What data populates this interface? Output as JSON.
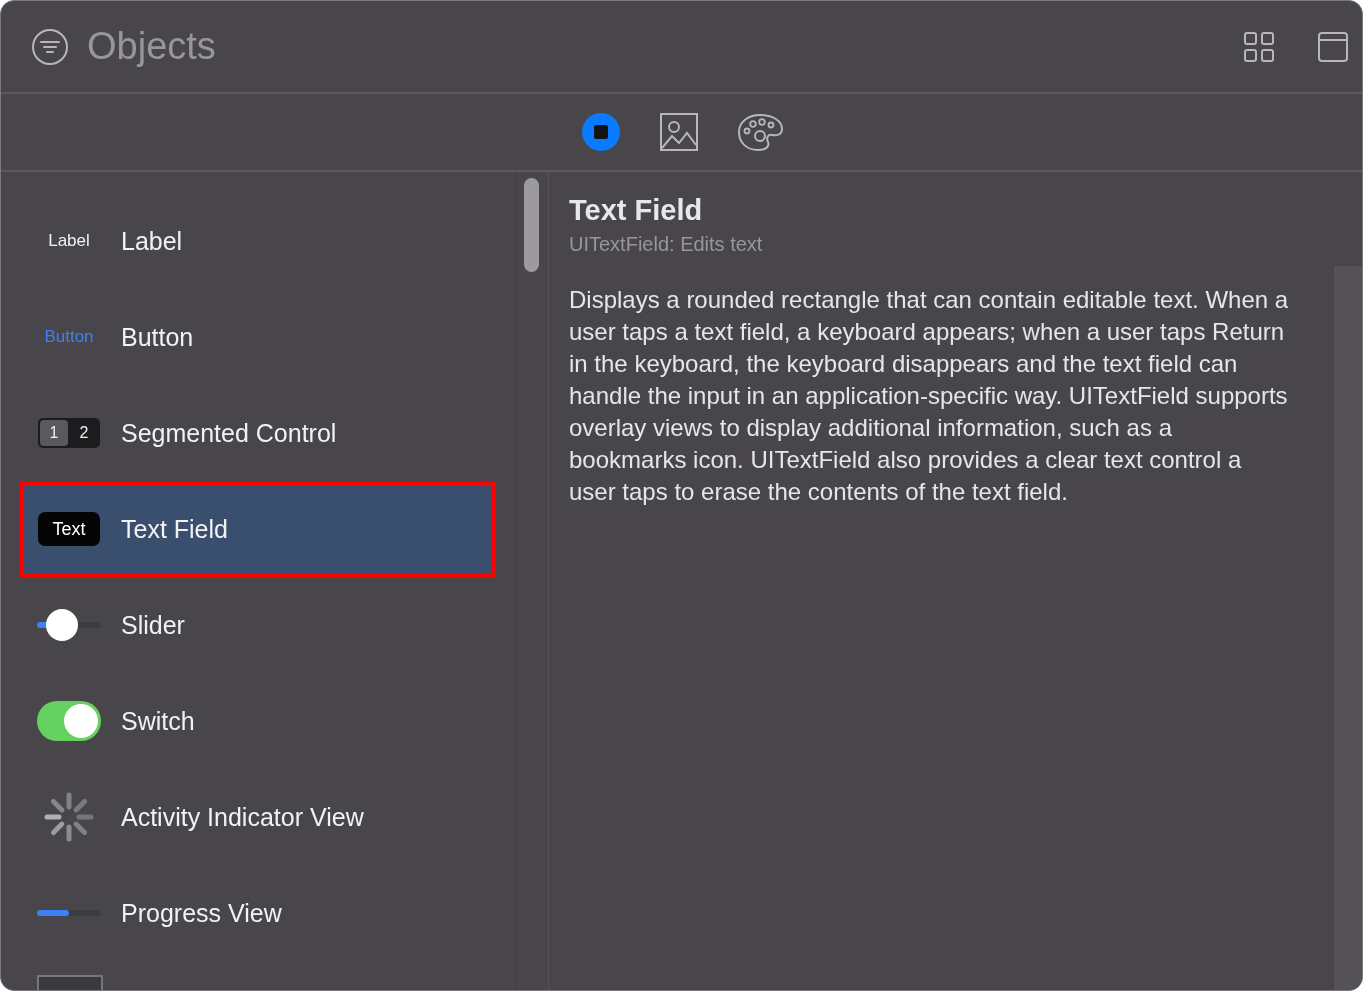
{
  "header": {
    "title": "Objects"
  },
  "tabs": [
    {
      "kind": "objects",
      "selected": true
    },
    {
      "kind": "image",
      "selected": false
    },
    {
      "kind": "palette",
      "selected": false
    }
  ],
  "items": [
    {
      "kind": "label",
      "preview_text": "Label",
      "name": "Label",
      "selected": false
    },
    {
      "kind": "button",
      "preview_text": "Button",
      "name": "Button",
      "selected": false
    },
    {
      "kind": "segmented",
      "segments": [
        "1",
        "2"
      ],
      "name": "Segmented Control",
      "selected": false
    },
    {
      "kind": "textfield",
      "preview_text": "Text",
      "name": "Text Field",
      "selected": true
    },
    {
      "kind": "slider",
      "level": 0.2,
      "name": "Slider",
      "selected": false
    },
    {
      "kind": "switch",
      "on": true,
      "name": "Switch",
      "selected": false
    },
    {
      "kind": "activity",
      "name": "Activity Indicator View",
      "selected": false
    },
    {
      "kind": "progress",
      "level": 0.5,
      "name": "Progress View",
      "selected": false
    },
    {
      "kind": "box"
    }
  ],
  "detail": {
    "title": "Text Field",
    "subtitle": "UITextField: Edits text",
    "description": "Displays a rounded rectangle that can contain editable text. When a user taps a text field, a keyboard appears; when a user taps Return in the keyboard, the keyboard disappears and the text field can handle the input in an application-specific way. UITextField supports overlay views to display additional information, such as a bookmarks icon. UITextField also provides a clear text control a user taps to erase the contents of the text field."
  }
}
